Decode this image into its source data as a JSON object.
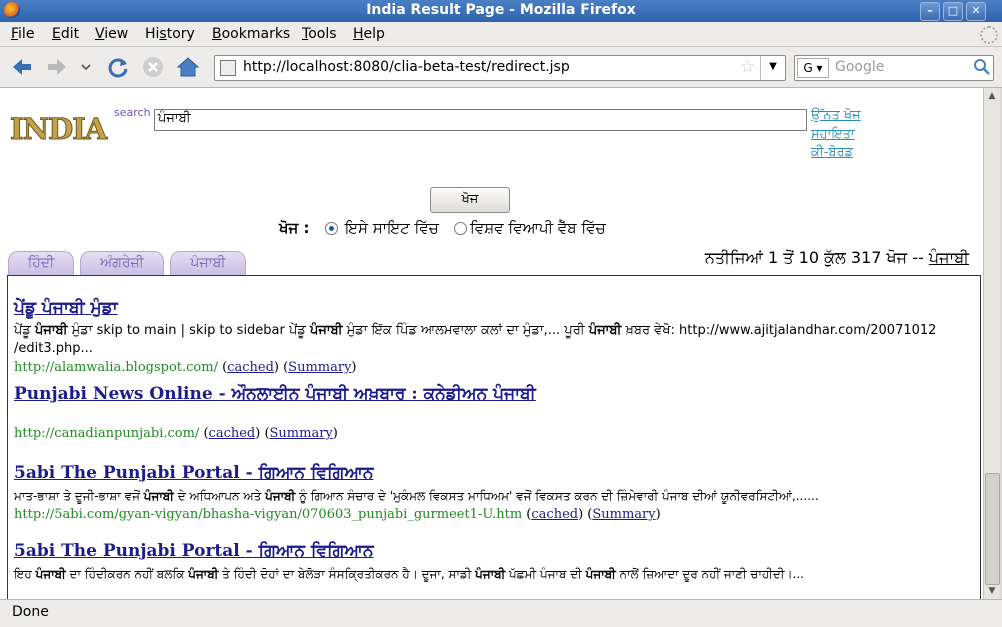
{
  "window": {
    "title": "India Result Page - Mozilla Firefox",
    "minimize": "–",
    "maximize": "□",
    "close": "✕"
  },
  "menubar": [
    {
      "u": "F",
      "rest": "ile"
    },
    {
      "u": "E",
      "rest": "dit"
    },
    {
      "u": "V",
      "rest": "iew"
    },
    {
      "pre": "Hi",
      "u": "s",
      "rest": "tory"
    },
    {
      "u": "B",
      "rest": "ookmarks"
    },
    {
      "u": "T",
      "rest": "ools"
    },
    {
      "u": "H",
      "rest": "elp"
    }
  ],
  "navbar": {
    "url": "http://localhost:8080/clia-beta-test/redirect.jsp",
    "search_engine": "G",
    "search_placeholder": "Google"
  },
  "page": {
    "logo_text": "INDIA",
    "logo_search": "search",
    "query": "ਪੰਜਾਬੀ",
    "side_links": [
      "ਉੱਨਤ ਖੋਜ",
      "ਸਹਾਇਤਾ",
      "ਕੀ-ਬੋਰਡ"
    ],
    "search_button": "ਖੋਜ",
    "scope_label": "ਖੋਜ :",
    "scope_options": [
      "ਇਸੇ ਸਾਇਟ ਵਿੱਚ",
      "ਵਿਸ਼ਵ ਵਿਆਪੀ ਵੈੱਬ ਵਿੱਚ"
    ],
    "tabs": [
      "ਹਿੰਦੀ",
      "ਅੰਗਰੇਜ਼ੀ",
      "ਪੰਜਾਬੀ"
    ],
    "results_info_prefix": "ਨਤੀਜਿਆਂ 1 ਤੋਂ 10 ਕੁੱਲ 317 ਖੋਜ --",
    "results_info_query": "ਪੰਜਾਬੀ",
    "cached_label": "cached",
    "summary_label": "Summary",
    "results": [
      {
        "title": "ਪੇਂਡੂ ਪੰਜਾਬੀ ਮੁੰਡਾ",
        "snippet_parts": [
          "ਪੇਂਡੂ ",
          "ਪੰਜਾਬੀ",
          " ਮੁੰਡਾ skip to main | skip to sidebar ਪੇਂਡੂ ",
          "ਪੰਜਾਬੀ",
          " ਮੁੰਡਾ ਇੱਕ ਪਿੰਡ ਆਲਮਵਾਲਾ ਕਲਾਂ ਦਾ ਮੁੰਡਾ,... ਪੂਰੀ ",
          "ਪੰਜਾਬੀ",
          " ਖ਼ਬਰ ਵੇਖੋ: http://www.ajitjalandhar.com/20071012 /edit3.php..."
        ],
        "url": "http://alamwalia.blogspot.com/"
      },
      {
        "title": "Punjabi News Online - ਔਨਲਾਈਨ ਪੰਜਾਬੀ ਅਖ਼ਬਾਰ : ਕਨੇਡੀਅਨ ਪੰਜਾਬੀ",
        "snippet_parts": [],
        "url": "http://canadianpunjabi.com/"
      },
      {
        "title": "5abi The Punjabi Portal - ਗਿਆਨ ਵਿਗਿਆਨ",
        "snippet_parts": [
          "ਮਾਤ-ਭਾਸ਼ਾ ਤੇ ਦੂਜੀ-ਭਾਸ਼ਾ ਵਜੋਂ ",
          "ਪੰਜਾਬੀ",
          " ਦੇ ਅਧਿਆਪਨ ਅਤੇ ",
          "ਪੰਜਾਬੀ",
          " ਨੂੰ ਗਿਆਨ ਸੰਚਾਰ ਦੇ 'ਮੁਕੰਮਲ ਵਿਕਸਤ ਮਾਧਿਅਮ' ਵਜੋਂ ਵਿਕਸਤ ਕਰਨ ਦੀ ਜ਼ਿੰਮੇਵਾਰੀ ਪੰਜਾਬ ਦੀਆਂ ਯੂਨੀਵਰਸਿਟੀਆਂ,......"
        ],
        "url": "http://5abi.com/gyan-vigyan/bhasha-vigyan/070603_punjabi_gurmeet1-U.htm"
      },
      {
        "title": "5abi The Punjabi Portal - ਗਿਆਨ ਵਿਗਿਆਨ",
        "snippet_parts": [
          "ਇਹ ",
          "ਪੰਜਾਬੀ",
          " ਦਾ ਹਿੰਦੀਕਰਨ ਨਹੀਂ ਬਲਕਿ ",
          "ਪੰਜਾਬੀ",
          " ਤੇ ਹਿੰਦੀ ਦੋਹਾਂ ਦਾ ਬੇਲੋੜਾ ਸੰਸਕ੍ਰਿਤੀਕਰਨ ਹੈ। ਦੂਜਾ, ਸਾਡੀ ",
          "ਪੰਜਾਬੀ",
          " ਪੱਛਮੀ ਪੰਜਾਬ ਦੀ ",
          "ਪੰਜਾਬੀ",
          " ਨਾਲੋਂ ਜ਼ਿਆਦਾ ਦੂਰ ਨਹੀਂ ਜਾਣੀ ਚਾਹੀਦੀ।..."
        ],
        "url": ""
      }
    ]
  },
  "status": "Done"
}
